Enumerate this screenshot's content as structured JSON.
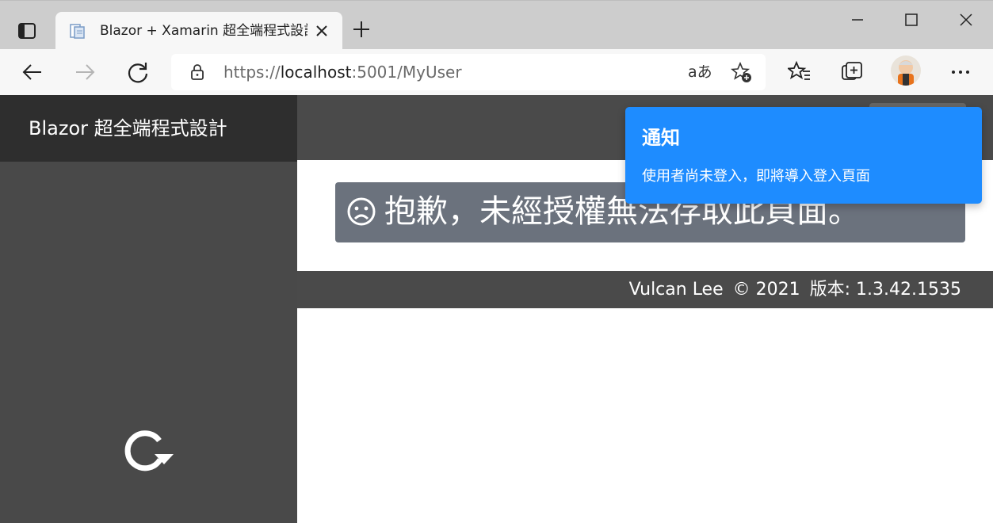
{
  "browser": {
    "tab_title": "Blazor + Xamarin 超全端程式設計",
    "url_scheme": "https://",
    "url_host": "localhost",
    "url_rest": ":5001/MyUser",
    "read_aloud_label": "aあ"
  },
  "app": {
    "brand": "Blazor 超全端程式設計",
    "alert_text": "抱歉，未經授權無法存取此頁面。",
    "footer": {
      "author": "Vulcan Lee",
      "copyright": "© 2021",
      "version": "版本: 1.3.42.1535"
    }
  },
  "toast": {
    "title": "通知",
    "message": "使用者尚未登入，即將導入登入頁面"
  },
  "colors": {
    "sidebar": "#494949",
    "brand_bar": "#2e2e2e",
    "alert_bg": "#6b727d",
    "toast_bg": "#1e8cff"
  }
}
